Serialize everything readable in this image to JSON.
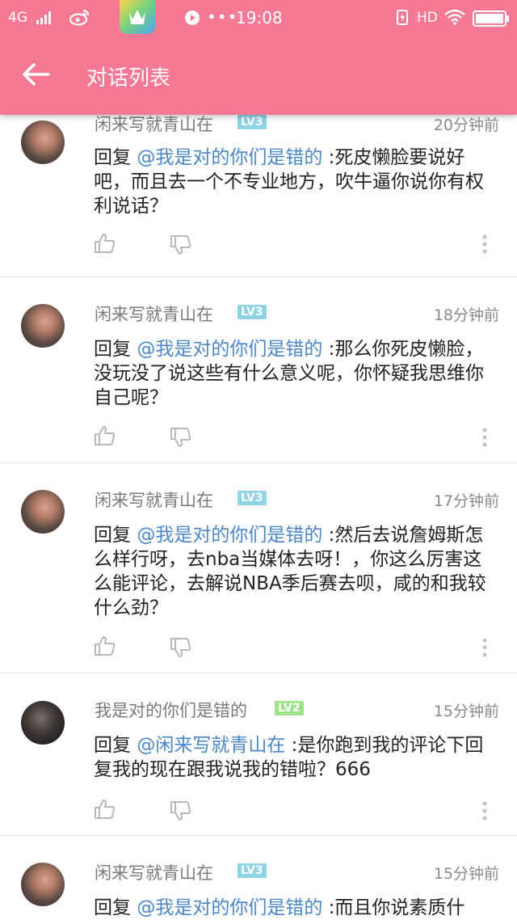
{
  "status_bar": {
    "network": "4G",
    "time": "19:08",
    "hd": "HD"
  },
  "toolbar": {
    "title": "对话列表"
  },
  "comments": [
    {
      "username": "闲来写就青山在",
      "level": "LV3",
      "time": "20分钟前",
      "reply_prefix": "回复 ",
      "mention": "@我是对的你们是错的",
      "text": " :死皮懒脸要说好吧，而且去一个不专业地方，吹牛逼你说你有权利说话？"
    },
    {
      "username": "闲来写就青山在",
      "level": "LV3",
      "time": "18分钟前",
      "reply_prefix": "回复 ",
      "mention": "@我是对的你们是错的",
      "text": " :那么你死皮懒脸，没玩没了说这些有什么意义呢，你怀疑我思维你自己呢？"
    },
    {
      "username": "闲来写就青山在",
      "level": "LV3",
      "time": "17分钟前",
      "reply_prefix": "回复 ",
      "mention": "@我是对的你们是错的",
      "text": " :然后去说詹姆斯怎么样行呀，去nba当媒体去呀！，你这么厉害这么能评论，去解说NBA季后赛去呗，咸的和我较什么劲？"
    },
    {
      "username": "我是对的你们是错的",
      "level": "LV2",
      "time": "15分钟前",
      "reply_prefix": "回复 ",
      "mention": "@闲来写就青山在",
      "text": " :是你跑到我的评论下回复我的现在跟我说我的错啦？666"
    },
    {
      "username": "闲来写就青山在",
      "level": "LV3",
      "time": "15分钟前",
      "reply_prefix": "回复 ",
      "mention": "@我是对的你们是错的",
      "text": " :而且你说素质什"
    }
  ]
}
